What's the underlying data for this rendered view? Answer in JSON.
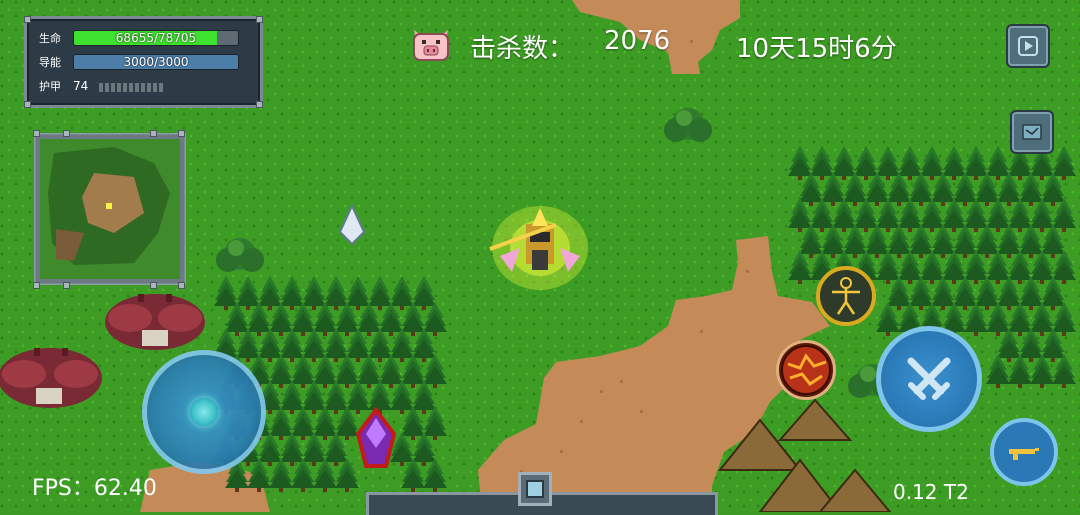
{
  "hud": {
    "hp_label": "生命",
    "hp_text": "68655/78705",
    "hp_fraction": 0.872,
    "ammo_label": "导能",
    "ammo_text": "3000/3000",
    "ammo_fraction": 1.0,
    "armor_label": "护甲",
    "armor_value": "74"
  },
  "top": {
    "kill_label": "击杀数：",
    "kill_count": "2076",
    "clock": "10天15时6分"
  },
  "footer": {
    "fps": "FPS：62.40",
    "version": "0.12 T2"
  },
  "colors": {
    "grass": "#3d9c24",
    "dirt": "#c48a57",
    "hp_bar": "#3ee12d",
    "ammo_bar": "#4d7ea8",
    "panel": "#2c3b46",
    "tree_dark": "#1f5e25"
  },
  "icons": {
    "kill_counter": "pig-face-icon",
    "pause": "play-pause-icon",
    "map_toggle": "map-scroll-icon",
    "joystick": "joystick-icon",
    "character_skill": "humanoid-figure-icon",
    "fire_skill": "magma-orb-icon",
    "attack": "crossed-swords-icon",
    "weapon_switch": "gun-icon"
  }
}
